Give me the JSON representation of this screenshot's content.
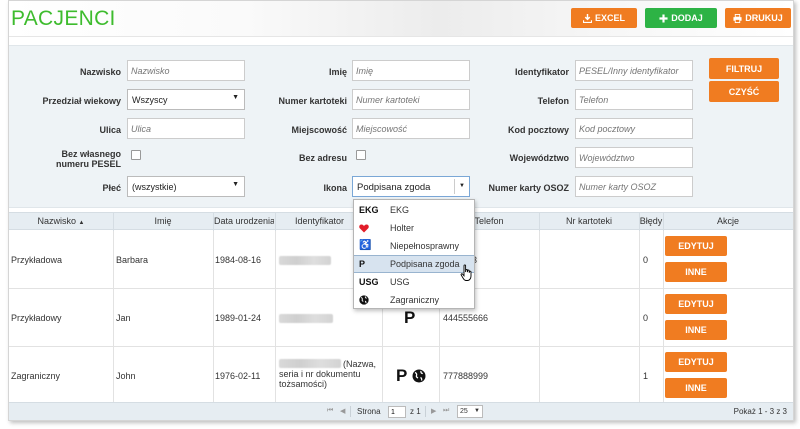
{
  "header": {
    "title": "PACJENCI",
    "buttons": {
      "excel": "EXCEL",
      "dodaj": "DODAJ",
      "drukuj": "DRUKUJ"
    }
  },
  "filters": {
    "nazwisko": {
      "label": "Nazwisko",
      "placeholder": "Nazwisko"
    },
    "imie": {
      "label": "Imię",
      "placeholder": "Imię"
    },
    "identyfikator": {
      "label": "Identyfikator",
      "placeholder": "PESEL/Inny identyfikator"
    },
    "przedzial": {
      "label": "Przedział wiekowy",
      "value": "Wszyscy"
    },
    "numer_kartoteki": {
      "label": "Numer kartoteki",
      "placeholder": "Numer kartoteki"
    },
    "telefon": {
      "label": "Telefon",
      "placeholder": "Telefon"
    },
    "ulica": {
      "label": "Ulica",
      "placeholder": "Ulica"
    },
    "miejscowosc": {
      "label": "Miejscowość",
      "placeholder": "Miejscowość"
    },
    "kod_pocztowy": {
      "label": "Kod pocztowy",
      "placeholder": "Kod pocztowy"
    },
    "bez_pesel": {
      "label_line1": "Bez własnego",
      "label_line2": "numeru PESEL"
    },
    "bez_adresu": {
      "label": "Bez adresu"
    },
    "wojewodztwo": {
      "label": "Województwo",
      "placeholder": "Województwo"
    },
    "plec": {
      "label": "Płeć",
      "value": "(wszystkie)"
    },
    "ikona": {
      "label": "Ikona",
      "value": "Podpisana zgoda"
    },
    "numer_osoz": {
      "label": "Numer karty OSOZ",
      "placeholder": "Numer karty OSOZ"
    },
    "filtruj": "FILTRUJ",
    "czysc": "CZYŚĆ"
  },
  "table": {
    "headers": {
      "nazwisko": "Nazwisko",
      "imie": "Imię",
      "data": "Data urodzenia",
      "identyfikator": "Identyfikator",
      "ikony": "",
      "telefon": "Telefon",
      "nr_kartoteki": "Nr kartoteki",
      "bledy": "Błędy",
      "akcje": "Akcje"
    },
    "sort_icon": "sort-ascending-icon",
    "rows": [
      {
        "nazwisko": "Przykładowa",
        "imie": "Barbara",
        "data": "1984-08-16",
        "telefon": "33",
        "bledy": "0"
      },
      {
        "nazwisko": "Przykładowy",
        "imie": "Jan",
        "data": "1989-01-24",
        "ikona": "P",
        "telefon": "444555666",
        "bledy": "0"
      },
      {
        "nazwisko": "Zagraniczny",
        "imie": "John",
        "data": "1976-02-11",
        "id_note_1": "(Nazwa,",
        "id_note_2": "seria i nr dokumentu",
        "id_note_3": "tożsamości)",
        "ikona": "P",
        "telefon": "777888999",
        "bledy": "1"
      }
    ],
    "edytuj": "EDYTUJ",
    "inne": "INNE"
  },
  "pager": {
    "strona_label": "Strona",
    "page": "1",
    "z_label": "z 1",
    "page_size": "25",
    "summary": "Pokaż 1 - 3 z 3"
  },
  "dropdown": {
    "items": [
      {
        "code": "EKG",
        "label": "EKG",
        "icon": "ekg-icon"
      },
      {
        "code": "",
        "label": "Holter",
        "icon": "heart-icon"
      },
      {
        "code": "",
        "label": "Niepełnosprawny",
        "icon": "wheelchair-icon"
      },
      {
        "code": "P",
        "label": "Podpisana zgoda",
        "icon": "consent-icon",
        "highlighted": true
      },
      {
        "code": "USG",
        "label": "USG",
        "icon": "usg-icon"
      },
      {
        "code": "",
        "label": "Zagraniczny",
        "icon": "globe-icon"
      }
    ]
  },
  "colors": {
    "title_green": "#3ebc2e",
    "orange": "#f07c21",
    "green_button": "#2db345",
    "filter_bg": "#eef3f6",
    "header_row_bg": "#e6edf2",
    "dropdown_highlight": "#d7e3ef",
    "heart_red": "#e21d2a"
  }
}
